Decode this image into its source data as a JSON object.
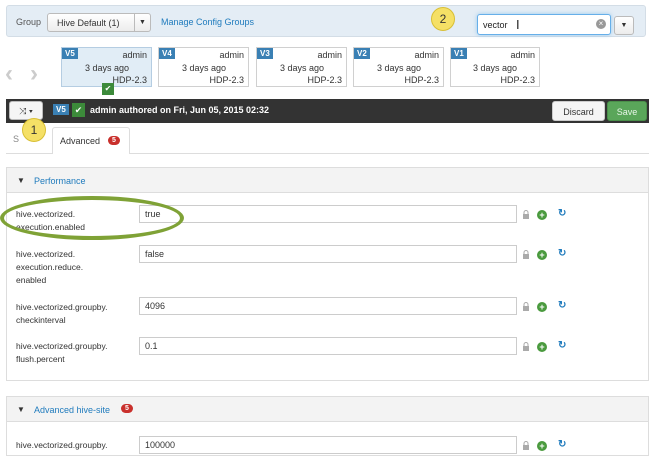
{
  "group_bar": {
    "label": "Group",
    "selected_group": "Hive Default (1)",
    "manage_link": "Manage Config Groups",
    "search_value": "vector"
  },
  "callouts": [
    "1",
    "2"
  ],
  "versions": [
    {
      "label": "V5",
      "author": "admin",
      "time": "3 days ago",
      "stack": "HDP-2.3",
      "current": true
    },
    {
      "label": "V4",
      "author": "admin",
      "time": "3 days ago",
      "stack": "HDP-2.3"
    },
    {
      "label": "V3",
      "author": "admin",
      "time": "3 days ago",
      "stack": "HDP-2.3"
    },
    {
      "label": "V2",
      "author": "admin",
      "time": "3 days ago",
      "stack": "HDP-2.3"
    },
    {
      "label": "V1",
      "author": "admin",
      "time": "3 days ago",
      "stack": "HDP-2.3"
    }
  ],
  "current_bar": {
    "version": "V5",
    "authored": "admin authored on Fri, Jun 05, 2015 02:32",
    "discard": "Discard",
    "save": "Save"
  },
  "tabs": {
    "settings": "S",
    "advanced": "Advanced",
    "advanced_badge": "5"
  },
  "performance": {
    "title": "Performance",
    "properties": [
      {
        "name": "hive.vectorized.\nexecution.enabled",
        "value": "true"
      },
      {
        "name": "hive.vectorized.\nexecution.reduce.\nenabled",
        "value": "false"
      },
      {
        "name": "hive.vectorized.groupby.\ncheckinterval",
        "value": "4096"
      },
      {
        "name": "hive.vectorized.groupby.\nflush.percent",
        "value": "0.1"
      }
    ]
  },
  "advanced_site": {
    "title": "Advanced hive-site",
    "badge": "5",
    "properties": [
      {
        "name": "hive.vectorized.groupby.",
        "value": "100000"
      }
    ]
  },
  "colors": {
    "accent": "#1f7bbd",
    "save_green": "#5aa65a",
    "badge_red": "#c9302c",
    "version_blue": "#3a80b4",
    "highlight_green": "#7fa236",
    "callout_yellow": "#f5e066"
  }
}
